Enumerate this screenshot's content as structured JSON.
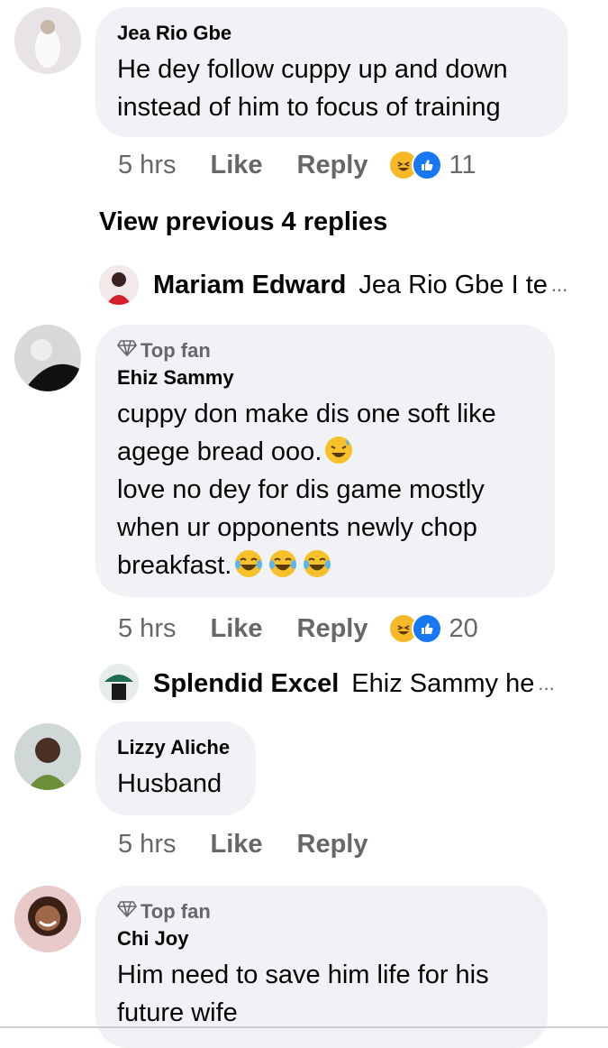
{
  "comments": [
    {
      "author": "Jea Rio Gbe",
      "lines": [
        "He dey follow cuppy up and down",
        "instead of him to focus of training"
      ],
      "time": "5 hrs",
      "like": "Like",
      "reply": "Reply",
      "reaction_count": "11"
    },
    {
      "top_fan": "Top fan",
      "author": "Ehiz Sammy",
      "lines": [
        "cuppy don make dis one soft like",
        "agege bread ooo.",
        "love no dey for dis game mostly",
        "when ur opponents newly chop",
        "breakfast."
      ],
      "time": "5 hrs",
      "like": "Like",
      "reply": "Reply",
      "reaction_count": "20"
    },
    {
      "author": "Lizzy Aliche",
      "lines": [
        "Husband"
      ],
      "time": "5 hrs",
      "like": "Like",
      "reply": "Reply"
    },
    {
      "top_fan": "Top fan",
      "author": "Chi Joy",
      "lines": [
        "Him need to save him life for his",
        "future wife"
      ]
    }
  ],
  "view_previous": "View previous 4 replies",
  "reply_previews": [
    {
      "name": "Mariam Edward",
      "snippet": "Jea Rio Gbe I te",
      "ellipsis": "..."
    },
    {
      "name": "Splendid Excel",
      "snippet": "Ehiz Sammy he",
      "ellipsis": "..."
    }
  ],
  "icons": {
    "reaction_haha": "haha-emoji-icon",
    "reaction_like": "like-thumb-icon",
    "top_fan": "diamond-icon",
    "inline_emoji": "laughing-emoji-icon"
  },
  "colors": {
    "bubble": "#f0f2f5",
    "meta": "#65676b",
    "like_blue": "#1877f2",
    "haha_yellow": "#f7b928"
  }
}
